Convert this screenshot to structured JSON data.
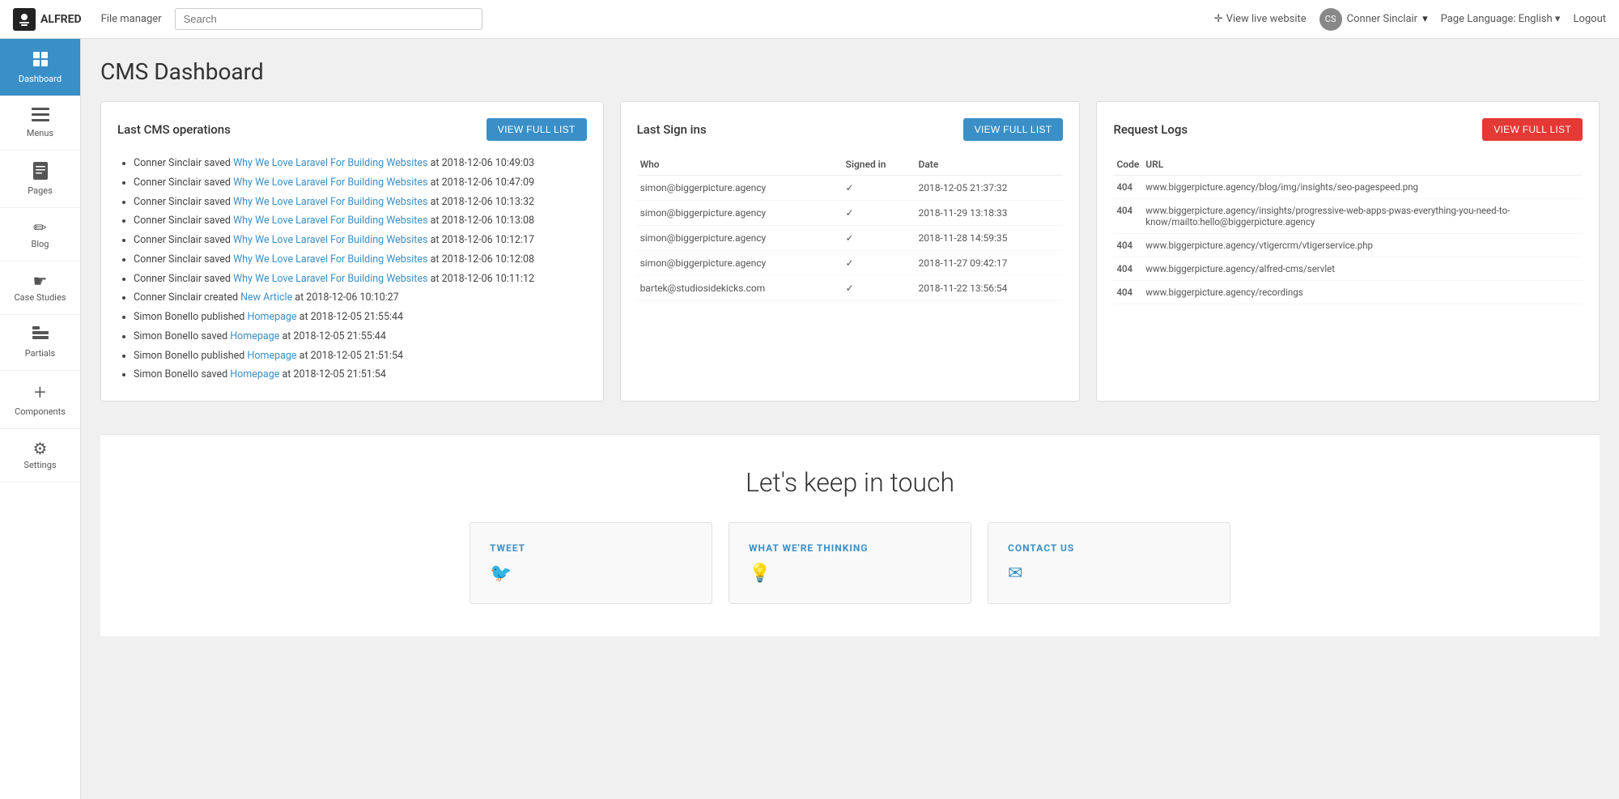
{
  "topnav": {
    "logo_text": "ALFRED",
    "file_manager_label": "File manager",
    "search_placeholder": "Search",
    "view_live_label": "View live website",
    "user_name": "Conner Sinclair",
    "user_dropdown": "▾",
    "page_language_label": "Page Language:",
    "page_language_value": "English",
    "page_language_dropdown": "▾",
    "logout_label": "Logout"
  },
  "sidebar": {
    "items": [
      {
        "id": "dashboard",
        "label": "Dashboard",
        "icon": "▦",
        "active": true
      },
      {
        "id": "menus",
        "label": "Menus",
        "icon": "☰",
        "active": false
      },
      {
        "id": "pages",
        "label": "Pages",
        "icon": "📄",
        "active": false
      },
      {
        "id": "blog",
        "label": "Blog",
        "icon": "✏",
        "active": false
      },
      {
        "id": "case-studies",
        "label": "Case Studies",
        "icon": "☛",
        "active": false
      },
      {
        "id": "partials",
        "label": "Partials",
        "icon": "⊞",
        "active": false
      },
      {
        "id": "components",
        "label": "Components",
        "icon": "+",
        "active": false
      },
      {
        "id": "settings",
        "label": "Settings",
        "icon": "⚙",
        "active": false
      }
    ]
  },
  "main": {
    "page_title": "CMS Dashboard",
    "cms_operations": {
      "title": "Last CMS operations",
      "view_full_list": "VIEW FULL LIST",
      "items": [
        {
          "text_before": "Conner Sinclair saved ",
          "link_text": "Why We Love Laravel For Building Websites",
          "text_after": " at 2018-12-06 10:49:03"
        },
        {
          "text_before": "Conner Sinclair saved ",
          "link_text": "Why We Love Laravel For Building Websites",
          "text_after": " at 2018-12-06 10:47:09"
        },
        {
          "text_before": "Conner Sinclair saved ",
          "link_text": "Why We Love Laravel For Building Websites",
          "text_after": " at 2018-12-06 10:13:32"
        },
        {
          "text_before": "Conner Sinclair saved ",
          "link_text": "Why We Love Laravel For Building Websites",
          "text_after": " at 2018-12-06 10:13:08"
        },
        {
          "text_before": "Conner Sinclair saved ",
          "link_text": "Why We Love Laravel For Building Websites",
          "text_after": " at 2018-12-06 10:12:17"
        },
        {
          "text_before": "Conner Sinclair saved ",
          "link_text": "Why We Love Laravel For Building Websites",
          "text_after": " at 2018-12-06 10:12:08"
        },
        {
          "text_before": "Conner Sinclair saved ",
          "link_text": "Why We Love Laravel For Building Websites",
          "text_after": " at 2018-12-06 10:11:12"
        },
        {
          "text_before": "Conner Sinclair created ",
          "link_text": "New Article",
          "text_after": " at 2018-12-06 10:10:27"
        },
        {
          "text_before": "Simon Bonello published ",
          "link_text": "Homepage",
          "text_after": " at 2018-12-05 21:55:44"
        },
        {
          "text_before": "Simon Bonello saved ",
          "link_text": "Homepage",
          "text_after": " at 2018-12-05 21:55:44"
        },
        {
          "text_before": "Simon Bonello published ",
          "link_text": "Homepage",
          "text_after": " at 2018-12-05 21:51:54"
        },
        {
          "text_before": "Simon Bonello saved ",
          "link_text": "Homepage",
          "text_after": " at 2018-12-05 21:51:54"
        }
      ]
    },
    "sign_ins": {
      "title": "Last Sign ins",
      "view_full_list": "VIEW FULL LIST",
      "columns": [
        "Who",
        "Signed in",
        "Date"
      ],
      "rows": [
        {
          "who": "simon@biggerpicture.agency",
          "signed_in": "✓",
          "date": "2018-12-05 21:37:32"
        },
        {
          "who": "simon@biggerpicture.agency",
          "signed_in": "✓",
          "date": "2018-11-29 13:18:33"
        },
        {
          "who": "simon@biggerpicture.agency",
          "signed_in": "✓",
          "date": "2018-11-28 14:59:35"
        },
        {
          "who": "simon@biggerpicture.agency",
          "signed_in": "✓",
          "date": "2018-11-27 09:42:17"
        },
        {
          "who": "bartek@studiosidekicks.com",
          "signed_in": "✓",
          "date": "2018-11-22 13:56:54"
        }
      ]
    },
    "request_logs": {
      "title": "Request Logs",
      "view_full_list": "VIEW FULL LIST",
      "columns": [
        "Code",
        "URL"
      ],
      "rows": [
        {
          "code": "404",
          "url": "www.biggerpicture.agency/blog/img/insights/seo-pagespeed.png"
        },
        {
          "code": "404",
          "url": "www.biggerpicture.agency/insights/progressive-web-apps-pwas-everything-you-need-to-know/mailto:hello@biggerpicture.agency"
        },
        {
          "code": "404",
          "url": "www.biggerpicture.agency/vtigercrm/vtigerservice.php"
        },
        {
          "code": "404",
          "url": "www.biggerpicture.agency/alfred-cms/servlet"
        },
        {
          "code": "404",
          "url": "www.biggerpicture.agency/recordings"
        }
      ]
    }
  },
  "footer": {
    "title": "Let's keep in touch",
    "cards": [
      {
        "id": "tweet",
        "title": "TWEET",
        "icon": "🐦"
      },
      {
        "id": "thinking",
        "title": "WHAT WE'RE THINKING",
        "icon": "💡"
      },
      {
        "id": "contact",
        "title": "CONTACT US",
        "icon": "✉"
      }
    ]
  }
}
